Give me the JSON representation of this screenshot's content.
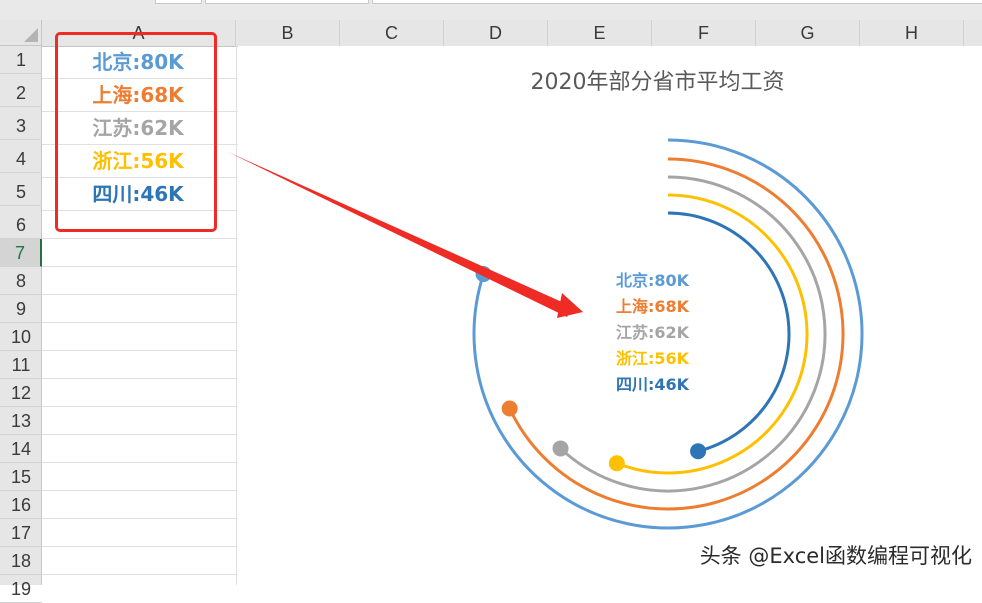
{
  "spreadsheet": {
    "columns": [
      "A",
      "B",
      "C",
      "D",
      "E",
      "F",
      "G",
      "H"
    ],
    "rows": [
      "1",
      "2",
      "3",
      "4",
      "5",
      "6",
      "7",
      "8",
      "9",
      "10",
      "11",
      "12",
      "13",
      "14",
      "15",
      "16",
      "17",
      "18",
      "19"
    ],
    "active_row": "7"
  },
  "cells": [
    {
      "text": "北京:80K",
      "color": "#5b9bd5"
    },
    {
      "text": "上海:68K",
      "color": "#ed7d31"
    },
    {
      "text": "江苏:62K",
      "color": "#a5a5a5"
    },
    {
      "text": "浙江:56K",
      "color": "#ffc000"
    },
    {
      "text": "四川:46K",
      "color": "#2e75b6"
    }
  ],
  "callout_color": "#ee2b24",
  "chart_data": {
    "type": "radial-bar",
    "title": "2020年部分省市平均工资",
    "series": [
      {
        "name": "北京",
        "value": 80,
        "color": "#5b9bd5"
      },
      {
        "name": "上海",
        "value": 68,
        "color": "#ed7d31"
      },
      {
        "name": "江苏",
        "value": 62,
        "color": "#a5a5a5"
      },
      {
        "name": "浙江",
        "value": 56,
        "color": "#ffc000"
      },
      {
        "name": "四川",
        "value": 46,
        "color": "#2e75b6"
      }
    ],
    "unit": "K",
    "scale_max": 100,
    "center_labels": [
      "北京:80K",
      "上海:68K",
      "江苏:62K",
      "浙江:56K",
      "四川:46K"
    ]
  },
  "watermark": "头条 @Excel函数编程可视化"
}
